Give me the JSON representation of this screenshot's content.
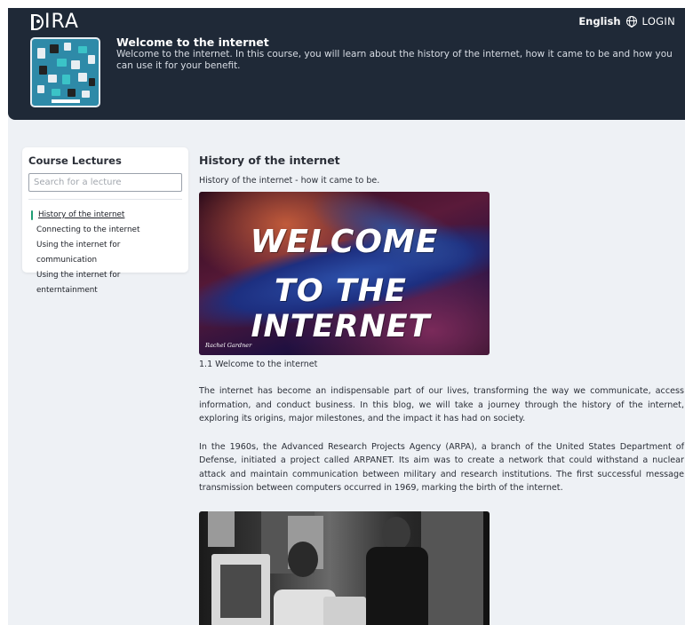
{
  "header": {
    "logo": "DIRA",
    "language": "English",
    "login_label": "LOGIN",
    "course_title": "Welcome to the internet",
    "course_description": "Welcome to the internet. In this course, you will learn about the history of the internet, how it came to be and how you can use it for your benefit."
  },
  "sidebar": {
    "title": "Course Lectures",
    "search_placeholder": "Search for a lecture",
    "items": [
      {
        "label": "History of the internet",
        "active": true
      },
      {
        "label": "Connecting to the internet",
        "active": false
      },
      {
        "label": "Using the internet for communication",
        "active": false
      },
      {
        "label": "Using the internet for enterntainment",
        "active": false
      }
    ]
  },
  "main": {
    "title": "History of the internet",
    "subtitle": "History of the internet - how it came to be.",
    "hero": {
      "line1": "WELCOME",
      "line2": "TO THE INTERNET",
      "signature": "Rachel Gardner"
    },
    "hero_caption": "1.1 Welcome to the internet",
    "paragraphs": [
      "The internet has become an indispensable part of our lives, transforming the way we communicate, access information, and conduct business. In this blog, we will take a journey through the history of the internet, exploring its origins, major milestones, and the impact it has had on society.",
      "In the 1960s, the Advanced Research Projects Agency (ARPA), a branch of the United States Department of Defense, initiated a project called ARPANET. Its aim was to create a network that could withstand a nuclear attack and maintain communication between military and research institutions. The first successful message transmission between computers occurred in 1969, marking the birth of the internet."
    ]
  },
  "colors": {
    "header_bg": "#1f2937",
    "page_bg": "#eef1f5",
    "active_accent": "#1f9e74"
  }
}
